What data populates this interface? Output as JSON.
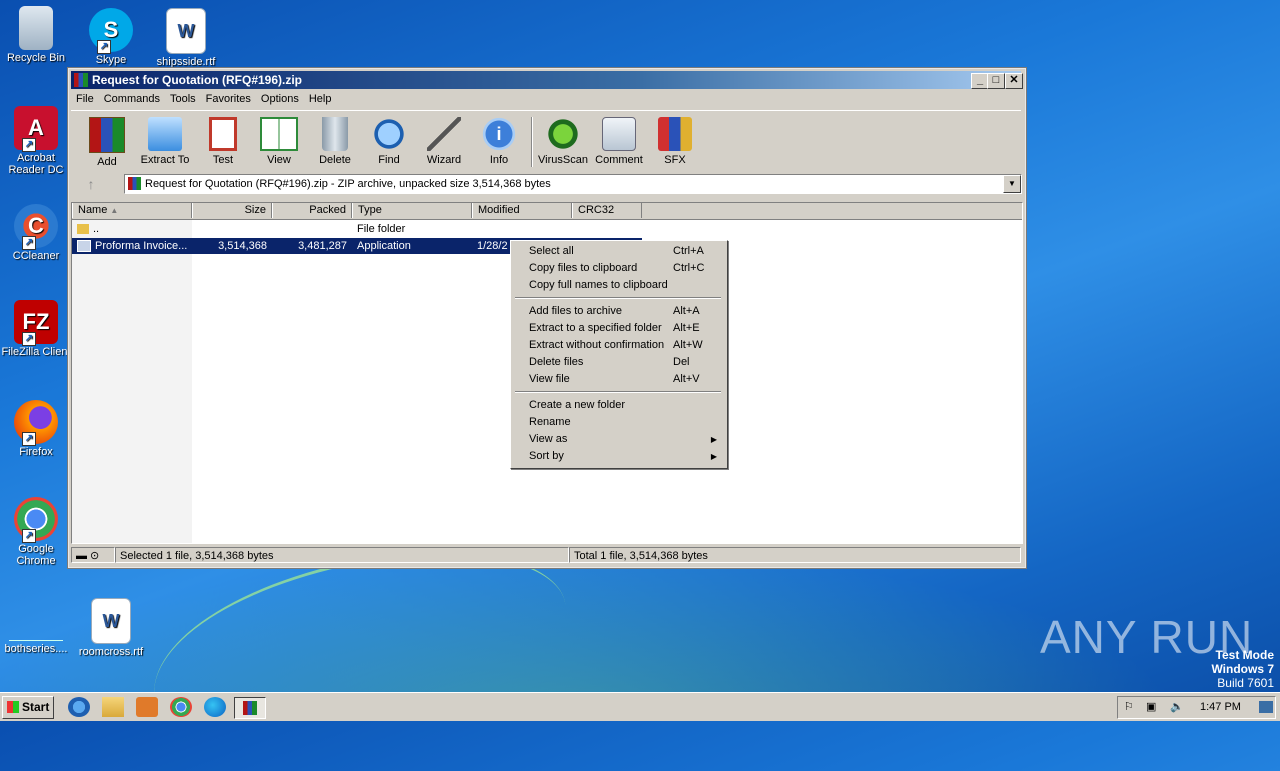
{
  "desktop": {
    "icons": [
      {
        "label": "Recycle Bin"
      },
      {
        "label": "Skype"
      },
      {
        "label": "shipsside.rtf"
      },
      {
        "label": "Acrobat Reader DC"
      },
      {
        "label": "CCleaner"
      },
      {
        "label": "FileZilla Client"
      },
      {
        "label": "Firefox"
      },
      {
        "label": "Google Chrome"
      },
      {
        "label": "bothseries...."
      },
      {
        "label": "roomcross.rtf"
      }
    ],
    "watermark": "ANY RUN",
    "test_mode": [
      "Test Mode",
      "Windows 7",
      "Build 7601"
    ]
  },
  "window": {
    "title": "Request for Quotation (RFQ#196).zip",
    "menu": [
      "File",
      "Commands",
      "Tools",
      "Favorites",
      "Options",
      "Help"
    ],
    "toolbar": [
      {
        "label": "Add",
        "icon": "add-archive-icon"
      },
      {
        "label": "Extract To",
        "icon": "extract-folder-icon"
      },
      {
        "label": "Test",
        "icon": "test-clipboard-icon"
      },
      {
        "label": "View",
        "icon": "view-book-icon"
      },
      {
        "label": "Delete",
        "icon": "trash-icon"
      },
      {
        "label": "Find",
        "icon": "magnifier-icon"
      },
      {
        "label": "Wizard",
        "icon": "wand-icon"
      },
      {
        "label": "Info",
        "icon": "info-icon"
      },
      {
        "label": "VirusScan",
        "icon": "bug-icon"
      },
      {
        "label": "Comment",
        "icon": "comment-icon"
      },
      {
        "label": "SFX",
        "icon": "sfx-box-icon"
      }
    ],
    "address": "Request for Quotation (RFQ#196).zip - ZIP archive, unpacked size 3,514,368 bytes",
    "columns": [
      "Name",
      "Size",
      "Packed",
      "Type",
      "Modified",
      "CRC32"
    ],
    "rows": [
      {
        "name": "..",
        "size": "",
        "packed": "",
        "type": "File folder",
        "modified": "",
        "crc": ""
      },
      {
        "name": "Proforma Invoice...",
        "size": "3,514,368",
        "packed": "3,481,287",
        "type": "Application",
        "modified": "1/28/2",
        "crc": ""
      }
    ],
    "status_left": "Selected 1 file, 3,514,368 bytes",
    "status_right": "Total 1 file, 3,514,368 bytes"
  },
  "context_menu": {
    "groups": [
      [
        {
          "label": "Select all",
          "shortcut": "Ctrl+A"
        },
        {
          "label": "Copy files to clipboard",
          "shortcut": "Ctrl+C"
        },
        {
          "label": "Copy full names to clipboard",
          "shortcut": ""
        }
      ],
      [
        {
          "label": "Add files to archive",
          "shortcut": "Alt+A"
        },
        {
          "label": "Extract to a specified folder",
          "shortcut": "Alt+E"
        },
        {
          "label": "Extract without confirmation",
          "shortcut": "Alt+W"
        },
        {
          "label": "Delete files",
          "shortcut": "Del"
        },
        {
          "label": "View file",
          "shortcut": "Alt+V"
        }
      ],
      [
        {
          "label": "Create a new folder",
          "shortcut": ""
        },
        {
          "label": "Rename",
          "shortcut": ""
        },
        {
          "label": "View as",
          "shortcut": "",
          "submenu": true
        },
        {
          "label": "Sort by",
          "shortcut": "",
          "submenu": true
        }
      ]
    ]
  },
  "taskbar": {
    "start_label": "Start",
    "clock": "1:47 PM"
  }
}
